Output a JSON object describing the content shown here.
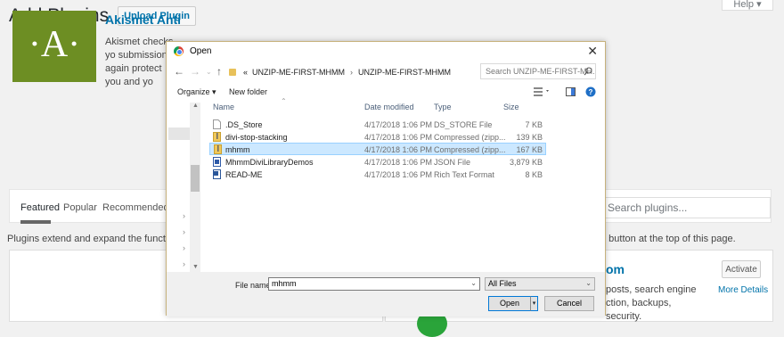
{
  "wp": {
    "title": "Add Plugins",
    "upload_button": "Upload Plugin",
    "help_tab": "Help",
    "tabs": [
      {
        "label": "Featured"
      },
      {
        "label": "Popular"
      },
      {
        "label": "Recommended"
      }
    ],
    "search_placeholder": "Search plugins...",
    "description_left": "Plugins extend and expand the functionality of W",
    "description_right": "e button at the top of this page.",
    "card_left": {
      "title": "Akismet Anti",
      "logo_text": "·A·",
      "text": "Akismet checks yo submissions again protect you and yo"
    },
    "card_right": {
      "title": "om",
      "text": "posts, search engine ction, backups, security.",
      "activate_button": "Activate",
      "more_details": "More Details"
    }
  },
  "dialog": {
    "title": "Open",
    "breadcrumb": [
      "«",
      "UNZIP-ME-FIRST-MHMM",
      "UNZIP-ME-FIRST-MHMM"
    ],
    "search_placeholder": "Search UNZIP-ME-FIRST-MH...",
    "toolbar": {
      "organize": "Organize ▾",
      "new_folder": "New folder"
    },
    "columns": {
      "name": "Name",
      "date": "Date modified",
      "type": "Type",
      "size": "Size"
    },
    "files": [
      {
        "name": ".DS_Store",
        "date": "4/17/2018 1:06 PM",
        "type": "DS_STORE File",
        "size": "7 KB",
        "icon": "blank-file-icon"
      },
      {
        "name": "divi-stop-stacking",
        "date": "4/17/2018 1:06 PM",
        "type": "Compressed (zipp...",
        "size": "139 KB",
        "icon": "zip-folder-icon"
      },
      {
        "name": "mhmm",
        "date": "4/17/2018 1:06 PM",
        "type": "Compressed (zipp...",
        "size": "167 KB",
        "icon": "zip-folder-icon",
        "selected": true
      },
      {
        "name": "MhmmDiviLibraryDemos",
        "date": "4/17/2018 1:06 PM",
        "type": "JSON File",
        "size": "3,879 KB",
        "icon": "json-file-icon"
      },
      {
        "name": "READ-ME",
        "date": "4/17/2018 1:06 PM",
        "type": "Rich Text Format",
        "size": "8 KB",
        "icon": "rtf-file-icon"
      }
    ],
    "file_name_label": "File name:",
    "file_name_value": "mhmm",
    "file_type": "All Files",
    "open_button": "Open",
    "cancel_button": "Cancel"
  },
  "colors": {
    "wp_link": "#0073aa",
    "akismet_green": "#6d8e23",
    "selection": "#cce8ff"
  }
}
